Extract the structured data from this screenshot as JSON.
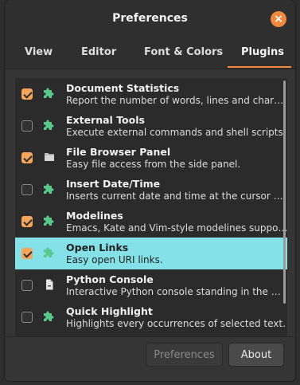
{
  "window": {
    "title": "Preferences"
  },
  "tabs": [
    {
      "label": "View"
    },
    {
      "label": "Editor"
    },
    {
      "label": "Font & Colors"
    },
    {
      "label": "Plugins",
      "active": true
    }
  ],
  "plugins": [
    {
      "name": "Document Statistics",
      "desc": "Report the number of words, lines and char…",
      "enabled": true,
      "icon": "puzzle-icon"
    },
    {
      "name": "External Tools",
      "desc": "Execute external commands and shell scripts.",
      "enabled": false,
      "icon": "puzzle-icon"
    },
    {
      "name": "File Browser Panel",
      "desc": "Easy file access from the side panel.",
      "enabled": true,
      "icon": "folder-icon"
    },
    {
      "name": "Insert Date/Time",
      "desc": "Inserts current date and time at the cursor …",
      "enabled": false,
      "icon": "puzzle-icon"
    },
    {
      "name": "Modelines",
      "desc": "Emacs, Kate and Vim-style modelines suppo…",
      "enabled": true,
      "icon": "puzzle-icon"
    },
    {
      "name": "Open Links",
      "desc": "Easy open URI links.",
      "enabled": true,
      "icon": "puzzle-icon",
      "selected": true
    },
    {
      "name": "Python Console",
      "desc": "Interactive Python console standing in the …",
      "enabled": false,
      "icon": "file-icon"
    },
    {
      "name": "Quick Highlight",
      "desc": "Highlights every occurrences of selected text.",
      "enabled": false,
      "icon": "puzzle-icon"
    }
  ],
  "footer": {
    "preferences_label": "Preferences",
    "about_label": "About"
  },
  "colors": {
    "accent": "#f0883e",
    "selection": "#84e1e7",
    "checkbox_on": "#f4a55a",
    "puzzle": "#58c98a"
  }
}
